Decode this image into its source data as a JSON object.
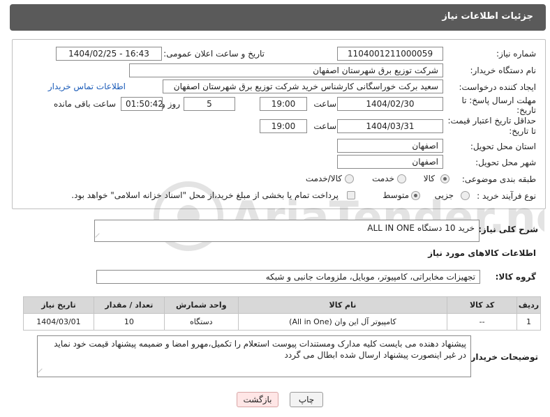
{
  "header": {
    "title": "جزئیات اطلاعات نیاز"
  },
  "form": {
    "need_number_label": "شماره نیاز:",
    "need_number": "1104001211000059",
    "announce_label": "تاریخ و ساعت اعلان عمومی:",
    "announce_value": "1404/02/25 - 16:43",
    "buyer_org_label": "نام دستگاه خریدار:",
    "buyer_org": "شرکت توزیع برق شهرستان اصفهان",
    "creator_label": "ایجاد کننده درخواست:",
    "creator": "سعید برکت خوراسگانی کارشناس خرید شرکت توزیع برق شهرستان اصفهان",
    "contact_link": "اطلاعات تماس خریدار",
    "deadline_label_1": "مهلت ارسال پاسخ: تا",
    "deadline_label_2": "تاریخ:",
    "deadline_date": "1404/02/30",
    "time_label": "ساعت",
    "deadline_time": "19:00",
    "days_value": "5",
    "days_label": "روز و",
    "remaining_time": "01:50:42",
    "remaining_label": "ساعت باقی مانده",
    "price_label_1": "حداقل تاریخ اعتبار قیمت:",
    "price_label_2": "تا تاریخ:",
    "price_date": "1404/03/31",
    "price_time": "19:00",
    "province_label": "استان محل تحویل:",
    "province": "اصفهان",
    "city_label": "شهر محل تحویل:",
    "city": "اصفهان",
    "category_label": "طبقه بندی موضوعی:",
    "category_options": [
      "کالا",
      "خدمت",
      "کالا/خدمت"
    ],
    "process_label": "نوع فرآیند خرید :",
    "process_options": [
      "جزیی",
      "متوسط"
    ],
    "payment_note": "پرداخت تمام یا بخشی از مبلغ خرید،از محل \"اسناد خزانه اسلامی\" خواهد بود."
  },
  "description": {
    "label": "شرح کلی نیاز:",
    "value": "خرید 10 دستگاه ALL IN ONE"
  },
  "goods": {
    "section_title": "اطلاعات کالاهای مورد نیاز",
    "group_label": "گروه کالا:",
    "group_value": "تجهیزات مخابراتی، کامپیوتر، موبایل، ملزومات جانبی و شبکه",
    "columns": [
      "ردیف",
      "کد کالا",
      "نام کالا",
      "واحد شمارش",
      "تعداد / مقدار",
      "تاریخ نیاز"
    ],
    "rows": [
      [
        "1",
        "--",
        "کامپیوتر آل این وان (All in One)",
        "دستگاه",
        "10",
        "1404/03/01"
      ]
    ]
  },
  "buyer_notes": {
    "label": "توضیحات خریدار:",
    "line1": "پیشنهاد دهنده می بایست کلیه مدارک ومستندات پیوست استعلام را تکمیل،مهرو امضا و ضمیمه پیشنهاد قیمت خود نماید",
    "line2": "در غیر اینصورت پیشنهاد ارسال شده ابطال می گردد"
  },
  "buttons": {
    "print": "چاپ",
    "back": "بازگشت"
  },
  "watermark": {
    "text": "AriaTender.neT"
  }
}
